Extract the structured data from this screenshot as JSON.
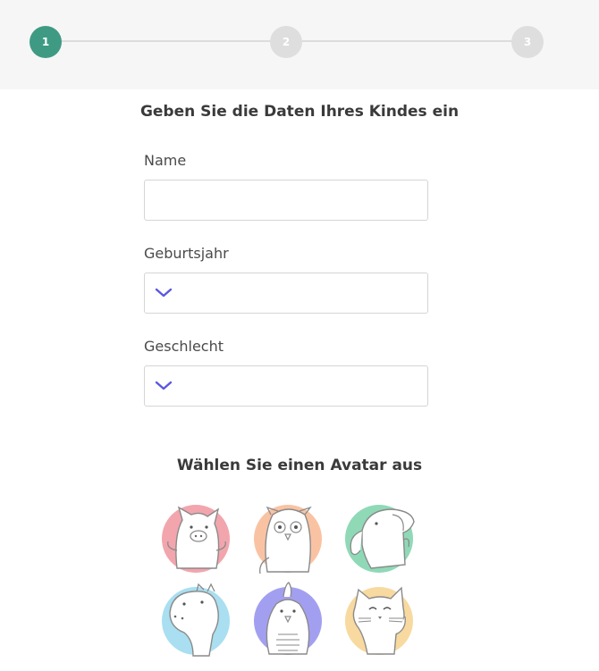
{
  "stepper": {
    "steps": [
      {
        "label": "1",
        "state": "active"
      },
      {
        "label": "2",
        "state": "inactive"
      },
      {
        "label": "3",
        "state": "inactive"
      }
    ],
    "colors": {
      "active": "#3f9a84",
      "inactive": "#dedede",
      "line": "#dcdcdc"
    }
  },
  "form": {
    "title": "Geben Sie die Daten Ihres Kindes ein",
    "name_label": "Name",
    "name_value": "",
    "birth_label": "Geburtsjahr",
    "birth_value": "",
    "gender_label": "Geschlecht",
    "gender_value": "",
    "accent": "#5b57e0"
  },
  "avatars": {
    "title": "Wählen Sie einen Avatar aus",
    "items": [
      {
        "icon": "pig-icon",
        "bg": "#f2a5ad"
      },
      {
        "icon": "owl-icon",
        "bg": "#f9c3a3"
      },
      {
        "icon": "elephant-icon",
        "bg": "#8fd9b7"
      },
      {
        "icon": "hippo-icon",
        "bg": "#a9dff0"
      },
      {
        "icon": "bird-icon",
        "bg": "#a39ff0"
      },
      {
        "icon": "cat-icon",
        "bg": "#f8d99f"
      }
    ]
  }
}
